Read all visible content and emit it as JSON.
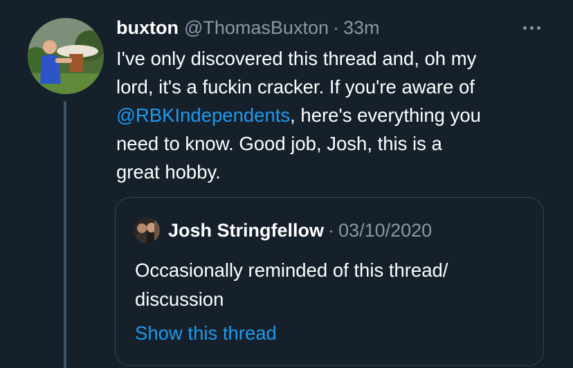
{
  "tweet": {
    "display_name": "buxton",
    "handle": "@ThomasBuxton",
    "separator": "·",
    "time": "33m",
    "body_lines": [
      "I've only discovered this thread and, oh my",
      "lord, it's a fuckin cracker. If you're aware of",
      ", here's everything you",
      "need to know. Good job, Josh, this is a",
      "great hobby."
    ],
    "mention": "@RBKIndependents",
    "more_icon": "more-horizontal-icon"
  },
  "quote": {
    "display_name": "Josh Stringfellow",
    "separator": "·",
    "date": "03/10/2020",
    "body_lines": [
      "Occasionally reminded of this thread/",
      "discussion"
    ],
    "show_thread": "Show this thread"
  },
  "colors": {
    "background": "#15202b",
    "text": "#ffffff",
    "muted": "#8b98a5",
    "link": "#1d9bf0",
    "border": "#38444d",
    "thread_line": "#3d5466"
  }
}
